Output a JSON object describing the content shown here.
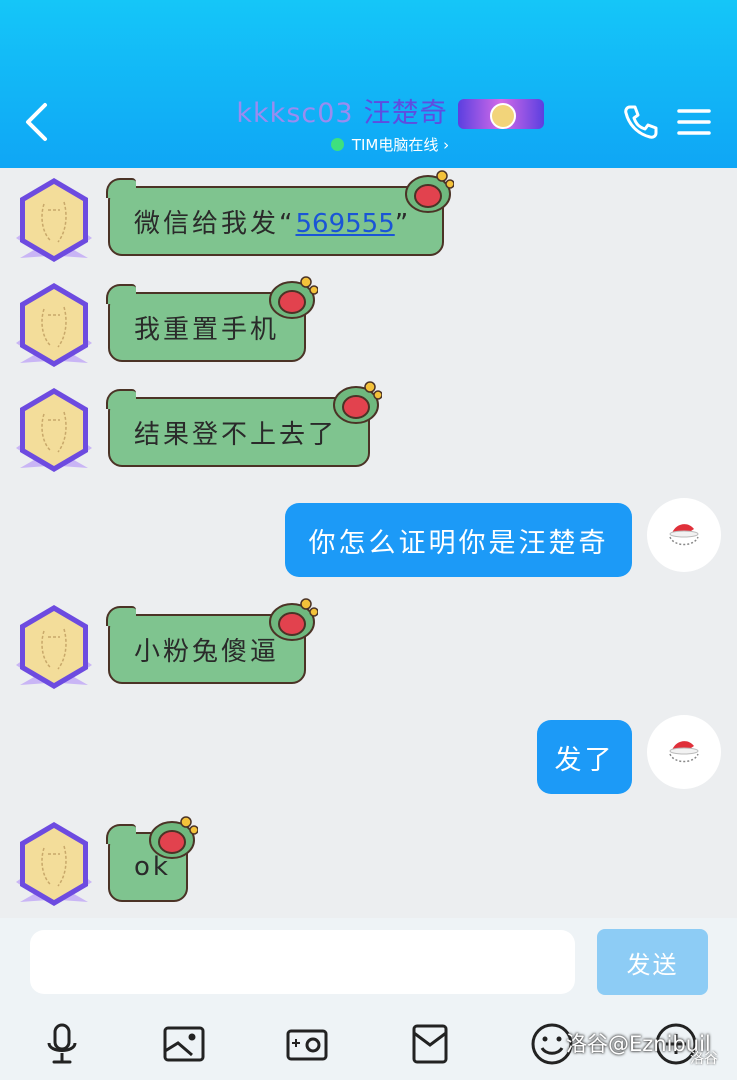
{
  "header": {
    "title_name": "kkksc03",
    "title_cn": "汪楚奇",
    "status_text": "TIM电脑在线 ›",
    "accent_color": "#0fa6f5"
  },
  "messages": [
    {
      "side": "left",
      "prefix": "微信给我发“",
      "link": "569555",
      "suffix": "”"
    },
    {
      "side": "left",
      "text": "我重置手机"
    },
    {
      "side": "left",
      "text": "结果登不上去了"
    },
    {
      "side": "right",
      "text": "你怎么证明你是汪楚奇"
    },
    {
      "side": "left",
      "text": "小粉兔傻逼"
    },
    {
      "side": "right",
      "text": "发了"
    },
    {
      "side": "left",
      "text": "ok"
    }
  ],
  "input": {
    "value": "",
    "placeholder": "",
    "send_label": "发送"
  },
  "toolbar": {
    "icons": [
      "microphone-icon",
      "image-icon",
      "camera-icon",
      "red-packet-icon",
      "emoji-icon",
      "plus-icon"
    ]
  },
  "watermark": {
    "main": "洛谷@Eznibuil",
    "small": "洛谷"
  }
}
